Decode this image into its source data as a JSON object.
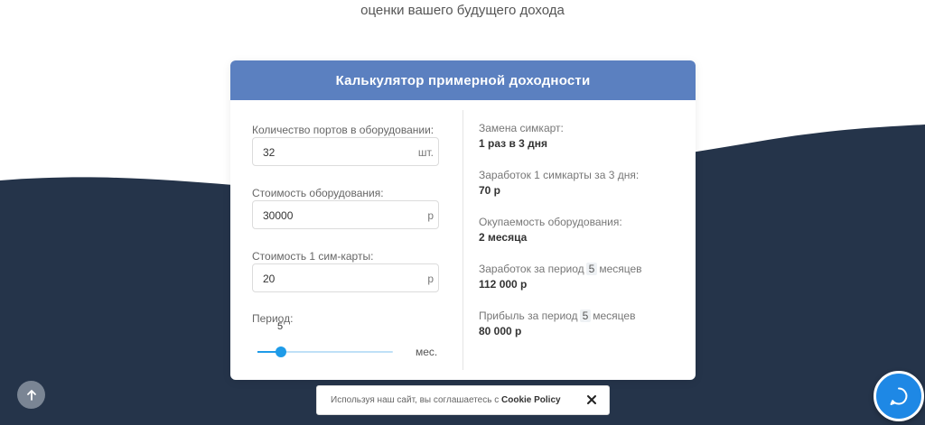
{
  "hero": {
    "subtitle": "оценки вашего будущего дохода"
  },
  "calculator": {
    "title": "Калькулятор примерной доходности",
    "fields": [
      {
        "label": "Количество портов в оборудовании:",
        "value": "32",
        "unit": "шт."
      },
      {
        "label": "Стоимость оборудования:",
        "value": "30000",
        "unit": "р"
      },
      {
        "label": "Стоимость 1 сим-карты:",
        "value": "20",
        "unit": "р"
      }
    ],
    "period": {
      "label": "Период:",
      "value": "5",
      "unit": "мес.",
      "fraction": 0.17
    },
    "results": [
      {
        "label": "Замена симкарт:",
        "value": "1 раз в 3 дня"
      },
      {
        "label": "Заработок 1 симкарты за 3 дня:",
        "value": "70 р"
      },
      {
        "label": "Окупаемость оборудования:",
        "value": "2 месяца"
      },
      {
        "label_prefix": "Заработок за период",
        "label_chip": "5",
        "label_suffix": "месяцев",
        "value": "112 000 р"
      },
      {
        "label_prefix": "Прибыль за период",
        "label_chip": "5",
        "label_suffix": "месяцев",
        "value": "80 000 р"
      }
    ]
  },
  "cookie_banner": {
    "text": "Используя наш сайт, вы соглашаетесь с",
    "link": "Cookie Policy"
  },
  "icons": {
    "scroll_up": "arrow-up-icon",
    "chat": "chat-bubble-icon",
    "close": "close-icon"
  },
  "colors": {
    "header": "#5b80c0",
    "wave": "#25344a",
    "accent": "#1e9be8",
    "chat": "#1e88e5"
  }
}
